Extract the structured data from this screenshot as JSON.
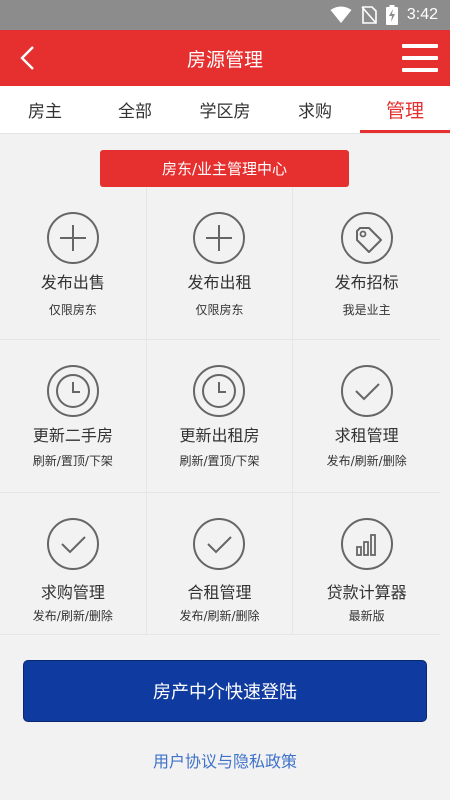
{
  "status_bar": {
    "time": "3:42",
    "icons": [
      "wifi-icon",
      "no-sim-icon",
      "battery-charging-icon"
    ]
  },
  "app_bar": {
    "title": "房源管理",
    "back_icon": "chevron-left-icon",
    "menu_icon": "hamburger-menu-icon"
  },
  "tabs": [
    {
      "label": "房主",
      "active": false
    },
    {
      "label": "全部",
      "active": false
    },
    {
      "label": "学区房",
      "active": false
    },
    {
      "label": "求购",
      "active": false
    },
    {
      "label": "管理",
      "active": true
    }
  ],
  "banner": {
    "label": "房东/业主管理中心"
  },
  "grid": [
    {
      "name": "发布出售",
      "sub": "仅限房东",
      "icon": "plus-circle-icon"
    },
    {
      "name": "发布出租",
      "sub": "仅限房东",
      "icon": "plus-circle-icon"
    },
    {
      "name": "发布招标",
      "sub": "我是业主",
      "icon": "tag-icon"
    },
    {
      "name": "更新二手房",
      "sub": "刷新/置顶/下架",
      "icon": "clock-icon"
    },
    {
      "name": "更新出租房",
      "sub": "刷新/置顶/下架",
      "icon": "clock-icon"
    },
    {
      "name": "求租管理",
      "sub": "发布/刷新/删除",
      "icon": "check-circle-icon"
    },
    {
      "name": "求购管理",
      "sub": "发布/刷新/删除",
      "icon": "check-circle-icon"
    },
    {
      "name": "合租管理",
      "sub": "发布/刷新/删除",
      "icon": "check-circle-icon"
    },
    {
      "name": "贷款计算器",
      "sub": "最新版",
      "icon": "bar-chart-icon"
    }
  ],
  "login_button": {
    "label": "房产中介快速登陆"
  },
  "policy_link": {
    "label": "用户协议与隐私政策"
  },
  "colors": {
    "brand_red": "#e5302f",
    "login_blue": "#0f3ba0",
    "link_blue": "#3f72c9",
    "icon_gray": "#666666"
  }
}
